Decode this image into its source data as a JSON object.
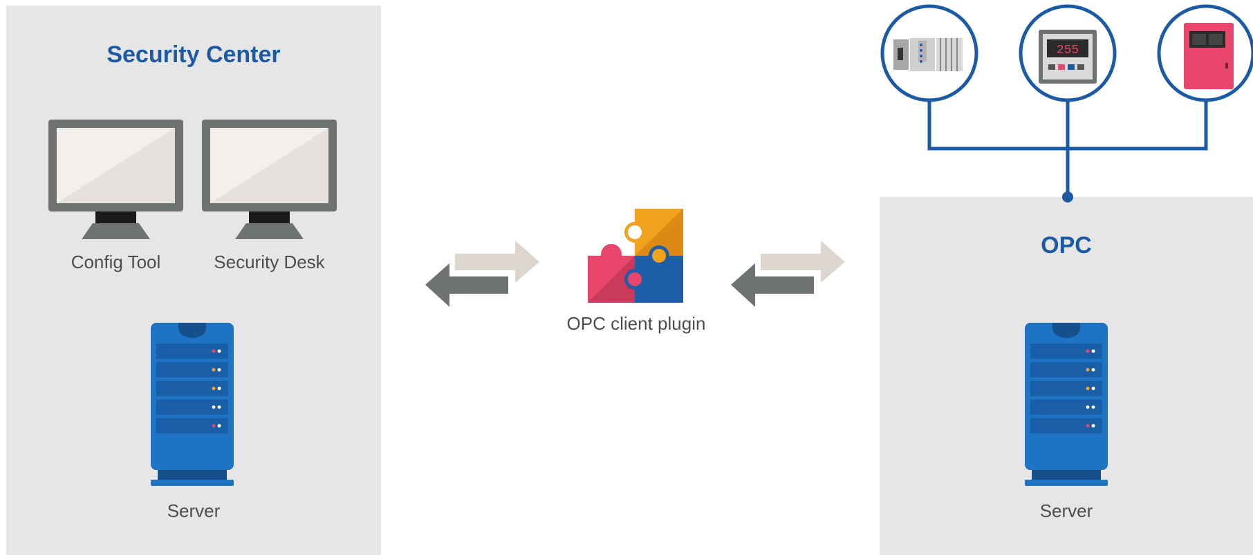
{
  "left": {
    "title": "Security Center",
    "workstations": [
      {
        "label": "Config Tool"
      },
      {
        "label": "Security Desk"
      }
    ],
    "server_label": "Server"
  },
  "middle": {
    "plugin_label": "OPC client plugin"
  },
  "right": {
    "title": "OPC",
    "server_label": "Server",
    "devices": [
      {
        "icon": "io-module-icon"
      },
      {
        "icon": "controller-display-icon",
        "display_value": "255"
      },
      {
        "icon": "panel-box-icon"
      }
    ]
  },
  "colors": {
    "brand_blue": "#1c5aa6",
    "panel_gray": "#e6e6e6",
    "arrow_dark": "#6f7273",
    "arrow_light": "#ddd6cf",
    "puzzle_pink": "#e8476b",
    "puzzle_orange": "#f3a21d",
    "puzzle_blue": "#1d5ea9"
  }
}
